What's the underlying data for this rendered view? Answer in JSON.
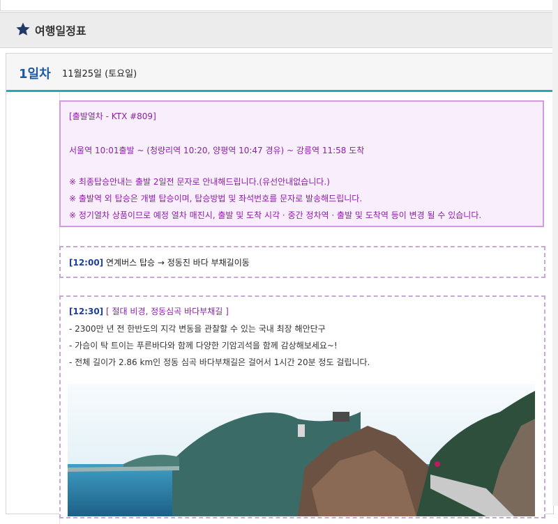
{
  "section": {
    "title": "여행일정표",
    "icon": "star-icon"
  },
  "day": {
    "label": "1일차",
    "date": "11월25일 (토요일)"
  },
  "train": {
    "heading": "[출발열차 - KTX #809]",
    "route": "서울역 10:01출발  ~ (청량리역 10:20, 양평역 10:47 경유) ~ 강릉역 11:58 도착",
    "notes": [
      "※ 최종탑승안내는 출발 2일전  문자로 안내해드립니다.(유선안내없습니다.)",
      "※ 출발역 외 탑승은 개별 탑승이며, 탑승방법 및 좌석번호를 문자로 발송해드립니다.",
      "※ 정기열차 상품이므로 예정 열차 매진시, 출발 및 도착 시각 · 중간 정차역 · 출발 및 도착역 등이 변경 될 수 있습니다."
    ]
  },
  "bus": {
    "time": "[12:00]",
    "text": "연계버스 탑승 → 정동진 바다 부채길이동"
  },
  "sight": {
    "time": "[12:30]",
    "title": "[ 절대 비경, 정동심곡 바다부채길 ]",
    "bullets": [
      "- 2300만 년 전 한반도의 지각 변동을 관찰할 수 있는 국내 최장 해안단구",
      "- 가슴이 탁 트이는 푸른바다와 함께 다양한 기암괴석을 함께 감상해보세요~!",
      "- 전체 길이가 2.86 km인 정동 심곡 바다부채길은  걸어서 1시간 20분 정도 걸립니다."
    ]
  },
  "colors": {
    "accent": "#24a9b5",
    "purple": "#8b1fa8",
    "navy": "#1d3e9e"
  }
}
